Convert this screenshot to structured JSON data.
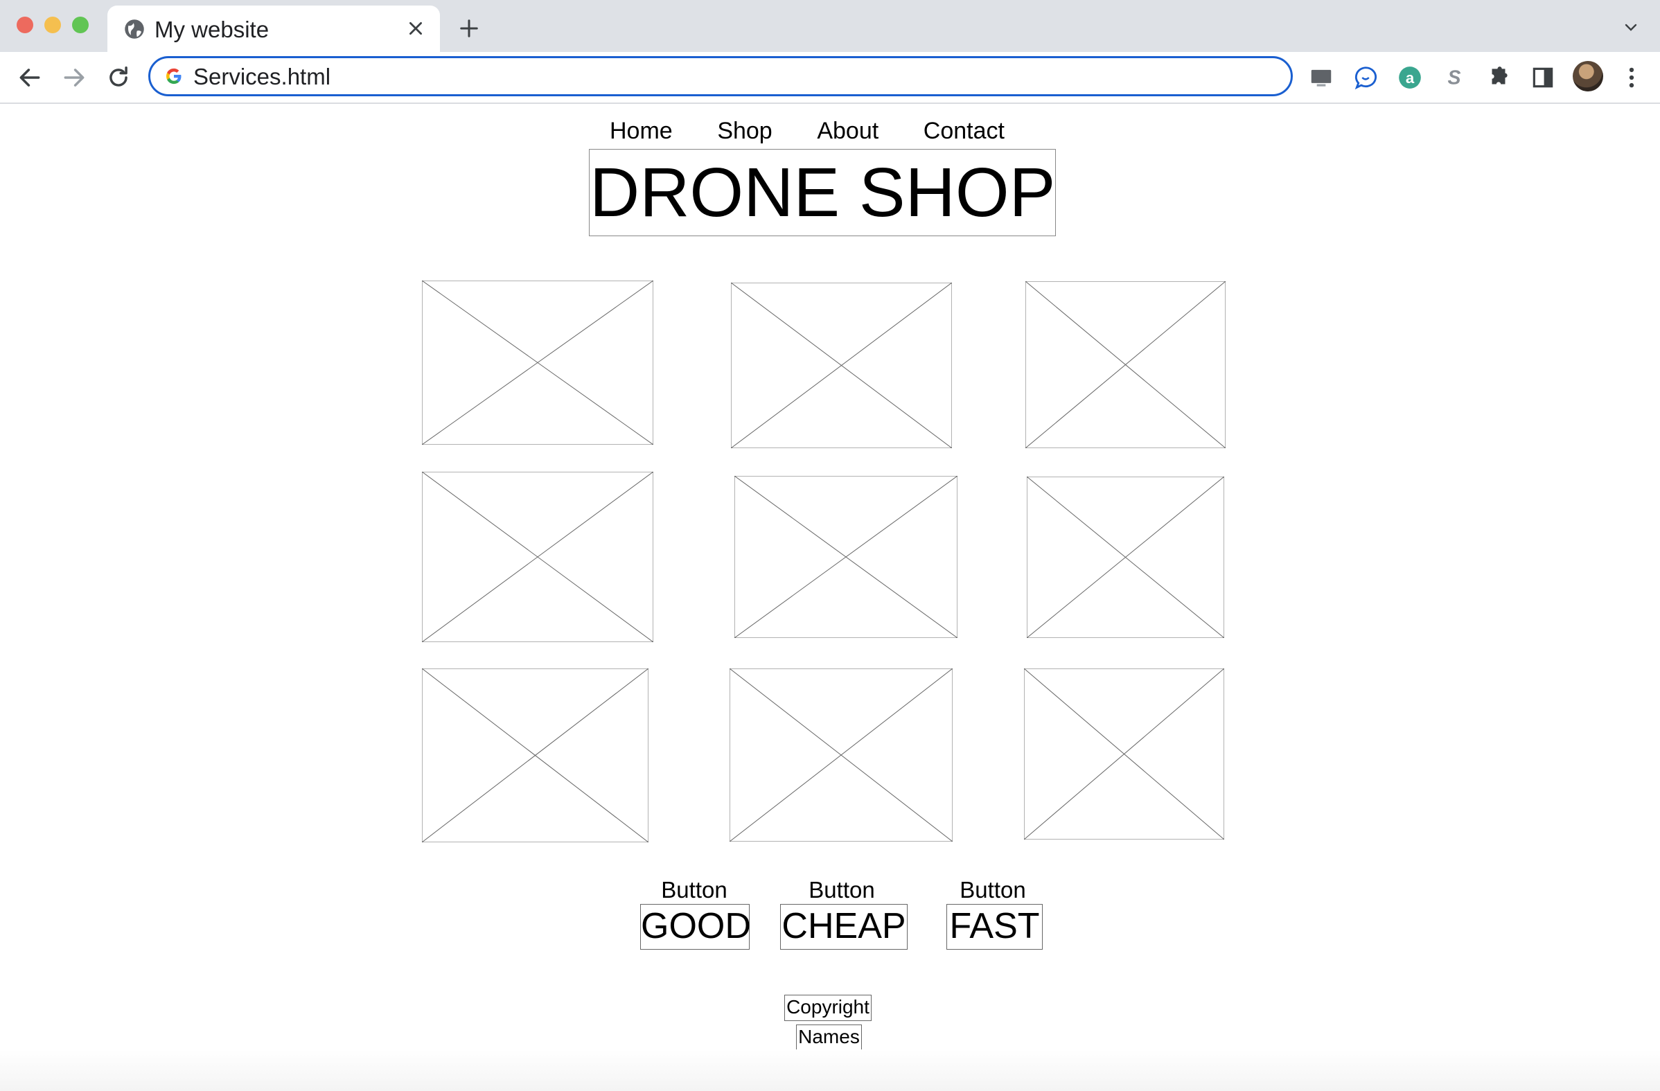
{
  "browser": {
    "tab_title": "My website",
    "url": "Services.html"
  },
  "nav": {
    "items": [
      "Home",
      "Shop",
      "About",
      "Contact"
    ]
  },
  "site": {
    "title": "DRONE SHOP"
  },
  "gallery": {
    "image_count": 9
  },
  "buttons": [
    {
      "caption": "Button",
      "label": "GOOD"
    },
    {
      "caption": "Button",
      "label": "CHEAP"
    },
    {
      "caption": "Button",
      "label": "FAST"
    }
  ],
  "footer": {
    "copyright": "Copyright",
    "names": "Names"
  },
  "colors": {
    "omnibox_border": "#1a5fd0",
    "tab_strip": "#dee1e6"
  }
}
